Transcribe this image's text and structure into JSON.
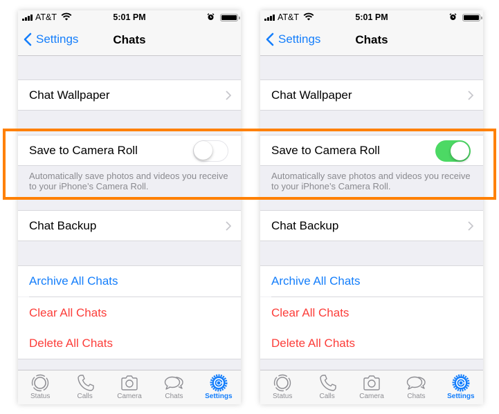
{
  "colors": {
    "accent": "#147efb",
    "destructive": "#fc3d39",
    "toggle_on": "#4cd964",
    "highlight": "#ff8000"
  },
  "phones": [
    {
      "status": {
        "carrier": "AT&T",
        "time": "5:01 PM"
      },
      "nav": {
        "back_label": "Settings",
        "title": "Chats"
      },
      "rows": {
        "wallpaper": "Chat Wallpaper",
        "save_camera_roll": "Save to Camera Roll",
        "save_camera_roll_on": false,
        "save_footer": "Automatically save photos and videos you receive to your iPhone’s Camera Roll.",
        "backup": "Chat Backup",
        "archive": "Archive All Chats",
        "clear": "Clear All Chats",
        "delete": "Delete All Chats"
      },
      "tabs": [
        {
          "label": "Status",
          "icon": "status-icon"
        },
        {
          "label": "Calls",
          "icon": "phone-icon"
        },
        {
          "label": "Camera",
          "icon": "camera-icon"
        },
        {
          "label": "Chats",
          "icon": "chat-bubbles-icon"
        },
        {
          "label": "Settings",
          "icon": "gear-icon",
          "active": true
        }
      ]
    },
    {
      "status": {
        "carrier": "AT&T",
        "time": "5:01 PM"
      },
      "nav": {
        "back_label": "Settings",
        "title": "Chats"
      },
      "rows": {
        "wallpaper": "Chat Wallpaper",
        "save_camera_roll": "Save to Camera Roll",
        "save_camera_roll_on": true,
        "save_footer": "Automatically save photos and videos you receive to your iPhone’s Camera Roll.",
        "backup": "Chat Backup",
        "archive": "Archive All Chats",
        "clear": "Clear All Chats",
        "delete": "Delete All Chats"
      },
      "tabs": [
        {
          "label": "Status",
          "icon": "status-icon"
        },
        {
          "label": "Calls",
          "icon": "phone-icon"
        },
        {
          "label": "Camera",
          "icon": "camera-icon"
        },
        {
          "label": "Chats",
          "icon": "chat-bubbles-icon"
        },
        {
          "label": "Settings",
          "icon": "gear-icon",
          "active": true
        }
      ]
    }
  ]
}
